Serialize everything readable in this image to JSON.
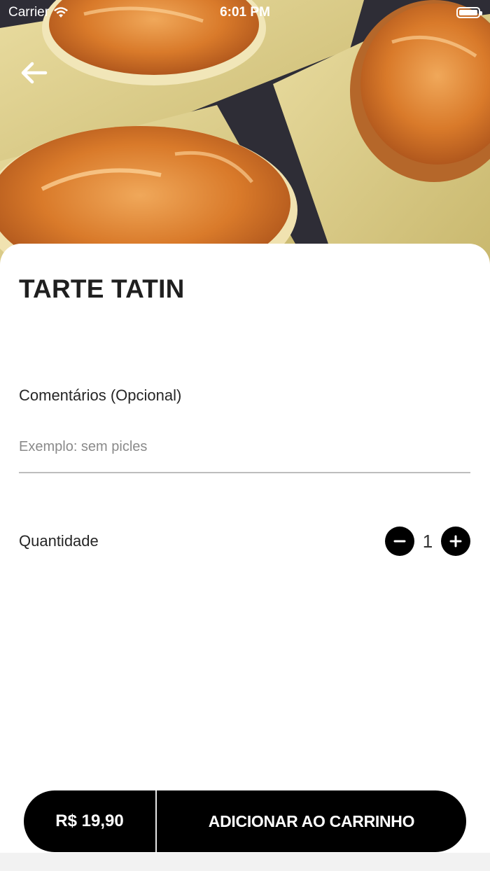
{
  "status_bar": {
    "carrier": "Carrier",
    "time": "6:01 PM"
  },
  "product": {
    "title": "TARTE TATIN",
    "image_icon": "tarte-tatin-photo"
  },
  "comments": {
    "label": "Comentários (Opcional)",
    "placeholder": "Exemplo: sem picles",
    "value": ""
  },
  "quantity": {
    "label": "Quantidade",
    "value": "1"
  },
  "cart": {
    "price": "R$ 19,90",
    "add_label": "ADICIONAR AO CARRINHO"
  },
  "colors": {
    "accent": "#000000",
    "background": "#ffffff"
  }
}
